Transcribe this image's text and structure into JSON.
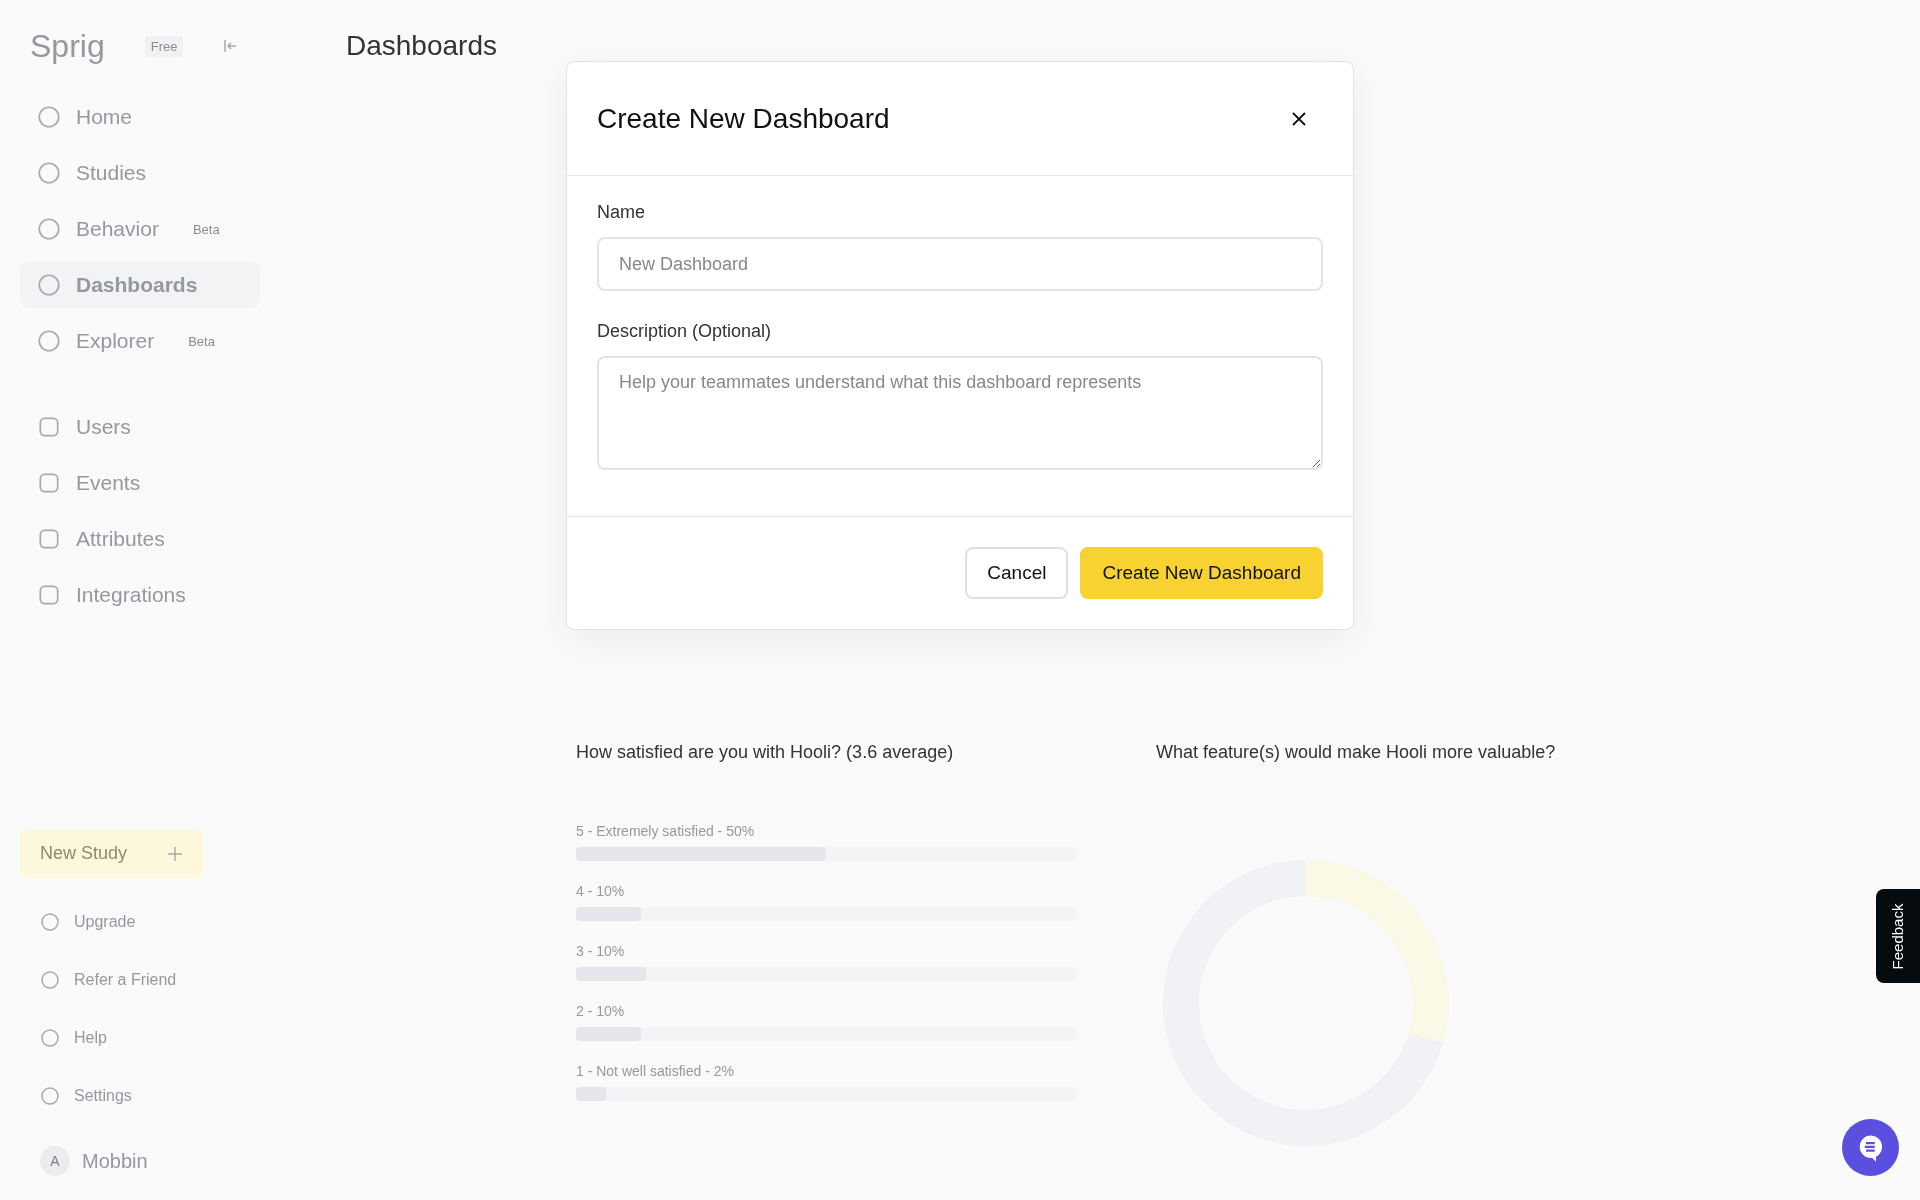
{
  "sidebar": {
    "logo": "Sprig",
    "badge": "Free",
    "nav": [
      {
        "label": "Home",
        "selected": false
      },
      {
        "label": "Studies",
        "selected": false
      },
      {
        "label": "Behavior",
        "tag": "Beta",
        "selected": false
      },
      {
        "label": "Dashboards",
        "selected": true
      },
      {
        "label": "Explorer",
        "tag": "Beta",
        "selected": false
      }
    ],
    "nav2": [
      {
        "label": "Users"
      },
      {
        "label": "Events"
      },
      {
        "label": "Attributes"
      },
      {
        "label": "Integrations"
      }
    ],
    "new_study": "New Study",
    "footer": [
      {
        "label": "Upgrade"
      },
      {
        "label": "Refer a Friend"
      },
      {
        "label": "Help"
      },
      {
        "label": "Settings"
      }
    ],
    "account": {
      "initial": "A",
      "name": "Mobbin"
    }
  },
  "page": {
    "title": "Dashboards",
    "cards": [
      {
        "title": "How satisfied are you with Hooli? (3.6 average)",
        "kind": "bars",
        "rows": [
          {
            "label": "5 - Extremely satisfied - 50%",
            "level": 0.5
          },
          {
            "label": "4 - 10%",
            "level": 0.13
          },
          {
            "label": "3 - 10%",
            "level": 0.14
          },
          {
            "label": "2 - 10%",
            "level": 0.13
          },
          {
            "label": "1 - Not well satisfied - 2%",
            "level": 0.06
          }
        ]
      },
      {
        "title": "What feature(s) would make Hooli more valuable?",
        "kind": "donut"
      }
    ]
  },
  "dialog": {
    "title": "Create New Dashboard",
    "fields": [
      {
        "label": "Name",
        "kind": "input",
        "placeholder": "New Dashboard"
      },
      {
        "label": "Description (Optional)",
        "kind": "textarea",
        "placeholder": "Help your teammates understand what this dashboard represents"
      }
    ],
    "buttons": [
      {
        "label": "Cancel",
        "kind": "secondary"
      },
      {
        "label": "Create New Dashboard",
        "kind": "primary"
      }
    ]
  },
  "feedback_tab": "Feedback"
}
